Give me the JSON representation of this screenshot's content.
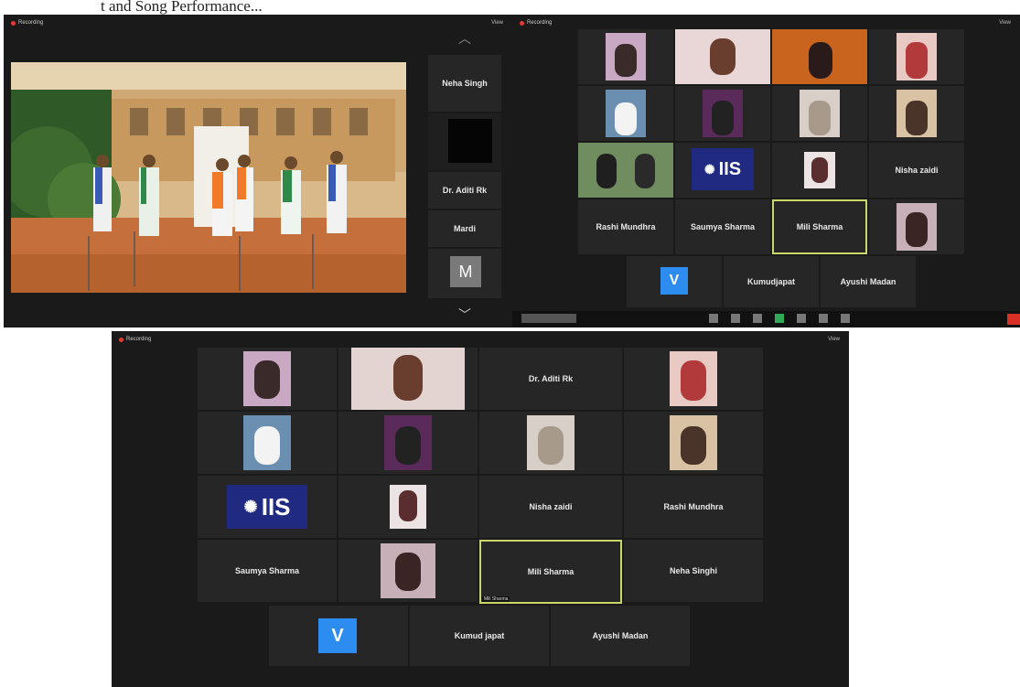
{
  "caption": "t and Song Performance...",
  "recording_label": "Recording",
  "view_label": "View",
  "window1": {
    "participants": [
      "Neha Singh",
      "",
      "Dr. Aditi Rk",
      "Mardi"
    ],
    "bottom_avatar": "M",
    "scroll_up": "︿",
    "scroll_down": "﹀"
  },
  "window2": {
    "names": [
      "Nisha zaidi",
      "Rashi Mundhra",
      "Saumya Sharma",
      "Mili Sharma",
      "Kumudjapat",
      "Ayushi Madan"
    ],
    "avatar": "V",
    "logo": "IIS",
    "toolbar": [
      "Mute",
      "Stop Video",
      "Security",
      "Participants",
      "Chat",
      "Share Screen",
      "Record",
      "Reactions",
      "Apps",
      "End"
    ]
  },
  "window3": {
    "names": {
      "dr_aditi": "Dr. Aditi Rk",
      "nisha": "Nisha zaidi",
      "rashi": "Rashi Mundhra",
      "saumya": "Saumya Sharma",
      "mili": "Mili Sharma",
      "neha": "Neha Singhi",
      "kumud": "Kumud japat",
      "ayushi": "Ayushi Madan"
    },
    "active_label": "Mili Sharma",
    "avatar": "V",
    "logo": "IIS"
  },
  "colors": {
    "window_bg": "#1a1a1a",
    "tile_bg": "#262626",
    "active_border": "#c8d66a",
    "avatar_blue": "#2d8cf0",
    "end_red": "#d93025"
  }
}
